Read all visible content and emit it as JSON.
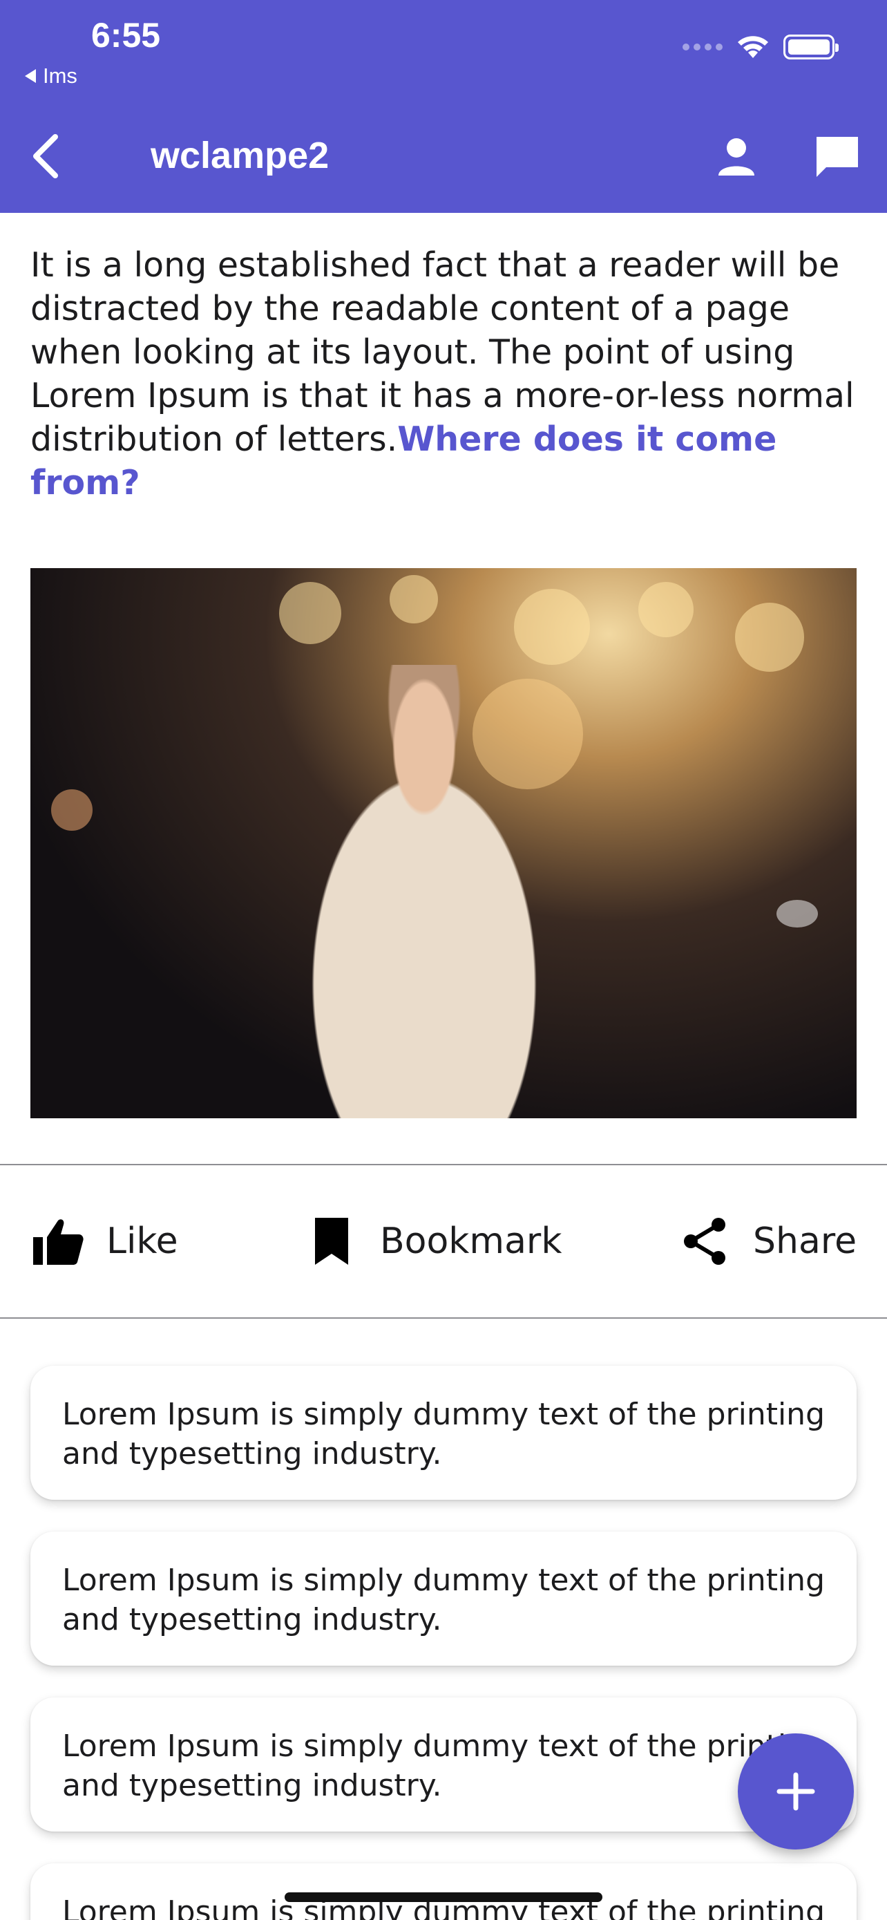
{
  "status_bar": {
    "time": "6:55",
    "back_app_label": "Ims"
  },
  "nav": {
    "title": "wclampe2",
    "back_icon": "chevron-left-icon",
    "profile_icon": "person-icon",
    "messages_icon": "chat-bubble-icon"
  },
  "post": {
    "text": "It is a long established fact that a reader will be distracted by the readable content of a page when looking at its layout. The point of using Lorem Ipsum is that it has a more-or-less normal distribution of letters.",
    "link_text": "Where does it come from?",
    "image_icon": "photo-woman-sparklers"
  },
  "actions": {
    "like_label": "Like",
    "bookmark_label": "Bookmark",
    "share_label": "Share"
  },
  "comments": [
    "Lorem Ipsum is simply dummy text of the printing and typesetting industry.",
    "Lorem Ipsum is simply dummy text of the printing and typesetting industry.",
    "Lorem Ipsum is simply dummy text of the printing and typesetting industry.",
    "Lorem Ipsum is simply dummy text of the printing and typesetting industry."
  ],
  "fab": {
    "icon": "plus-icon"
  },
  "colors": {
    "accent": "#5856cf"
  }
}
